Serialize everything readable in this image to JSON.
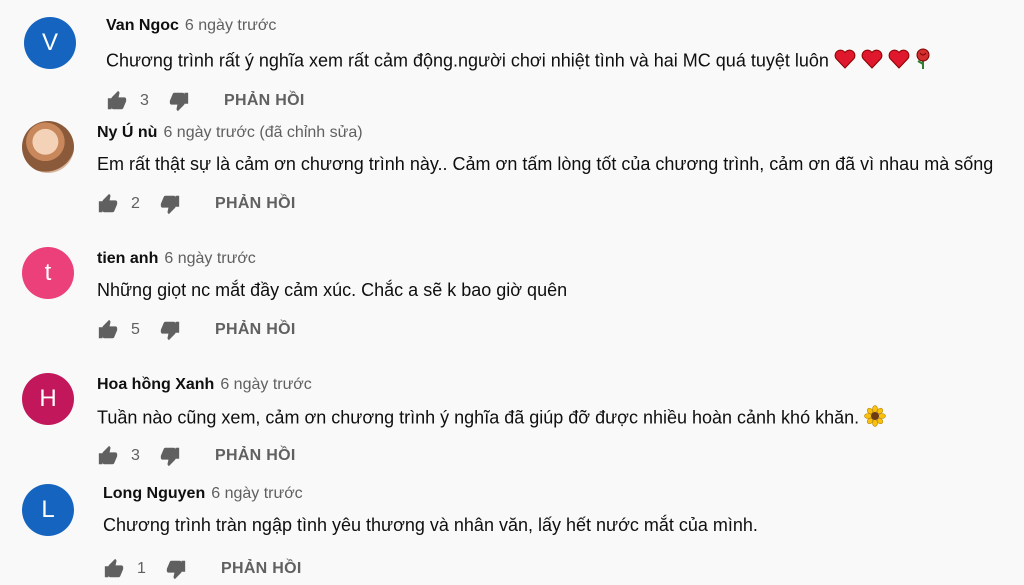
{
  "comments": [
    {
      "author": "Van Ngoc",
      "time": "6 ngày trước",
      "text": "Chương trình rất ý nghĩa xem rất cảm động.người chơi nhiệt  tình và hai MC quá tuyệt luôn",
      "emoji": [
        "red-heart",
        "red-heart",
        "red-heart",
        "rose"
      ],
      "likes": "3",
      "reply": "PHẢN HỒI",
      "avatar": {
        "letter": "V",
        "color": "#1565c0"
      }
    },
    {
      "author": "Ny Ú nù",
      "time": "6 ngày trước (đã chỉnh sửa)",
      "text": "Em rất thật sự là cảm ơn chương trình này.. Cảm ơn tấm lòng tốt của  chương trình, cảm ơn đã vì nhau mà sống",
      "emoji": [],
      "likes": "2",
      "reply": "PHẢN HỒI",
      "avatar": {
        "letter": "",
        "color": "#c9885c"
      }
    },
    {
      "author": "tien anh",
      "time": "6 ngày trước",
      "text": "Những giọt nc mắt đầy cảm xúc. Chắc a sẽ k bao giờ quên",
      "emoji": [],
      "likes": "5",
      "reply": "PHẢN HỒI",
      "avatar": {
        "letter": "t",
        "color": "#ec407a"
      }
    },
    {
      "author": "Hoa hồng Xanh",
      "time": "6 ngày trước",
      "text": "Tuần nào cũng xem, cảm ơn chương trình ý nghĩa đã giúp đỡ được nhiều hoàn cảnh khó khăn.",
      "emoji": [
        "sunflower"
      ],
      "likes": "3",
      "reply": "PHẢN HỒI",
      "avatar": {
        "letter": "H",
        "color": "#c2185b"
      }
    },
    {
      "author": "Long Nguyen",
      "time": "6 ngày trước",
      "text": "Chương trình tràn ngập tình yêu thương và nhân văn, lấy hết nước mắt của mình.",
      "emoji": [],
      "likes": "1",
      "reply": "PHẢN HỒI",
      "avatar": {
        "letter": "L",
        "color": "#1565c0"
      }
    }
  ]
}
